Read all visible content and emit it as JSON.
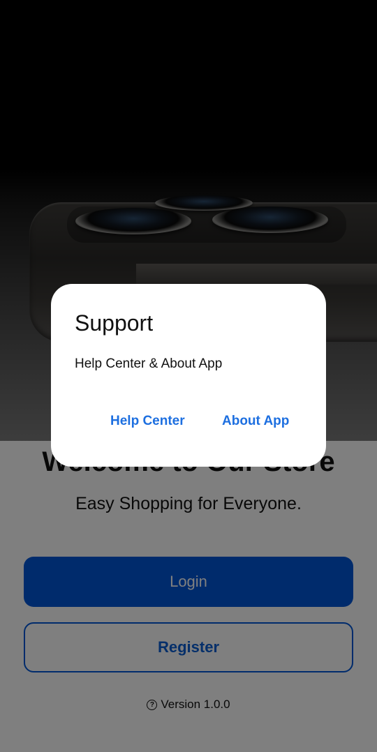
{
  "screen": {
    "welcome_title": "Welcome to Our Store",
    "subtitle": "Easy Shopping for Everyone.",
    "login_label": "Login",
    "register_label": "Register",
    "version_text": "Version 1.0.0",
    "version_icon": "help-circle-icon"
  },
  "dialog": {
    "title": "Support",
    "message": "Help Center & About App",
    "actions": [
      {
        "label": "Help Center"
      },
      {
        "label": "About App"
      }
    ]
  },
  "colors": {
    "primary": "#0057d8",
    "dialog_action": "#1d6fe0",
    "scrim": "rgba(0,0,0,0.5)"
  }
}
